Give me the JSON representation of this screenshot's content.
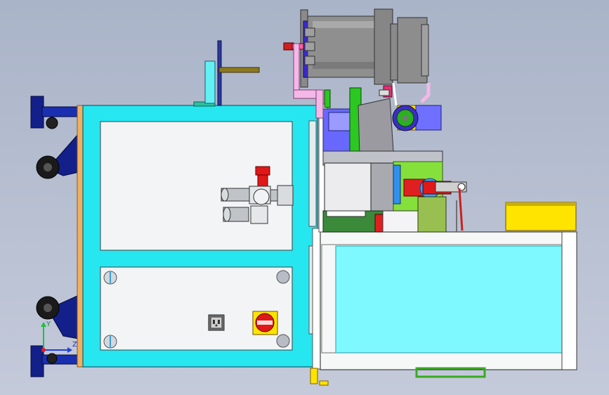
{
  "viewport": {
    "background_top": "#aab4c8",
    "background_bottom": "#c4cada"
  },
  "colors": {
    "cabinet_cyan": "#26e6f0",
    "cabinet_edge": "#1d9aa8",
    "panel_white": "#f2f4f6",
    "cabinet_orange": "#f0b060",
    "gearbox_grey": "#8f8f8f",
    "bracket_lime": "#9cf04a",
    "emergency_red": "#e01818",
    "warning_yellow": "#ffe400",
    "caster_navy": "#13208a",
    "rail_pink": "#f4b8e8",
    "bracket_purple": "#7070ff"
  },
  "controls": {
    "socket_icon": "power-socket-icon",
    "estop_icon": "emergency-stop-icon",
    "filter_icon": "air-filter-regulator-icon"
  },
  "triad": {
    "y_label": "Y",
    "z_label": "Z"
  }
}
